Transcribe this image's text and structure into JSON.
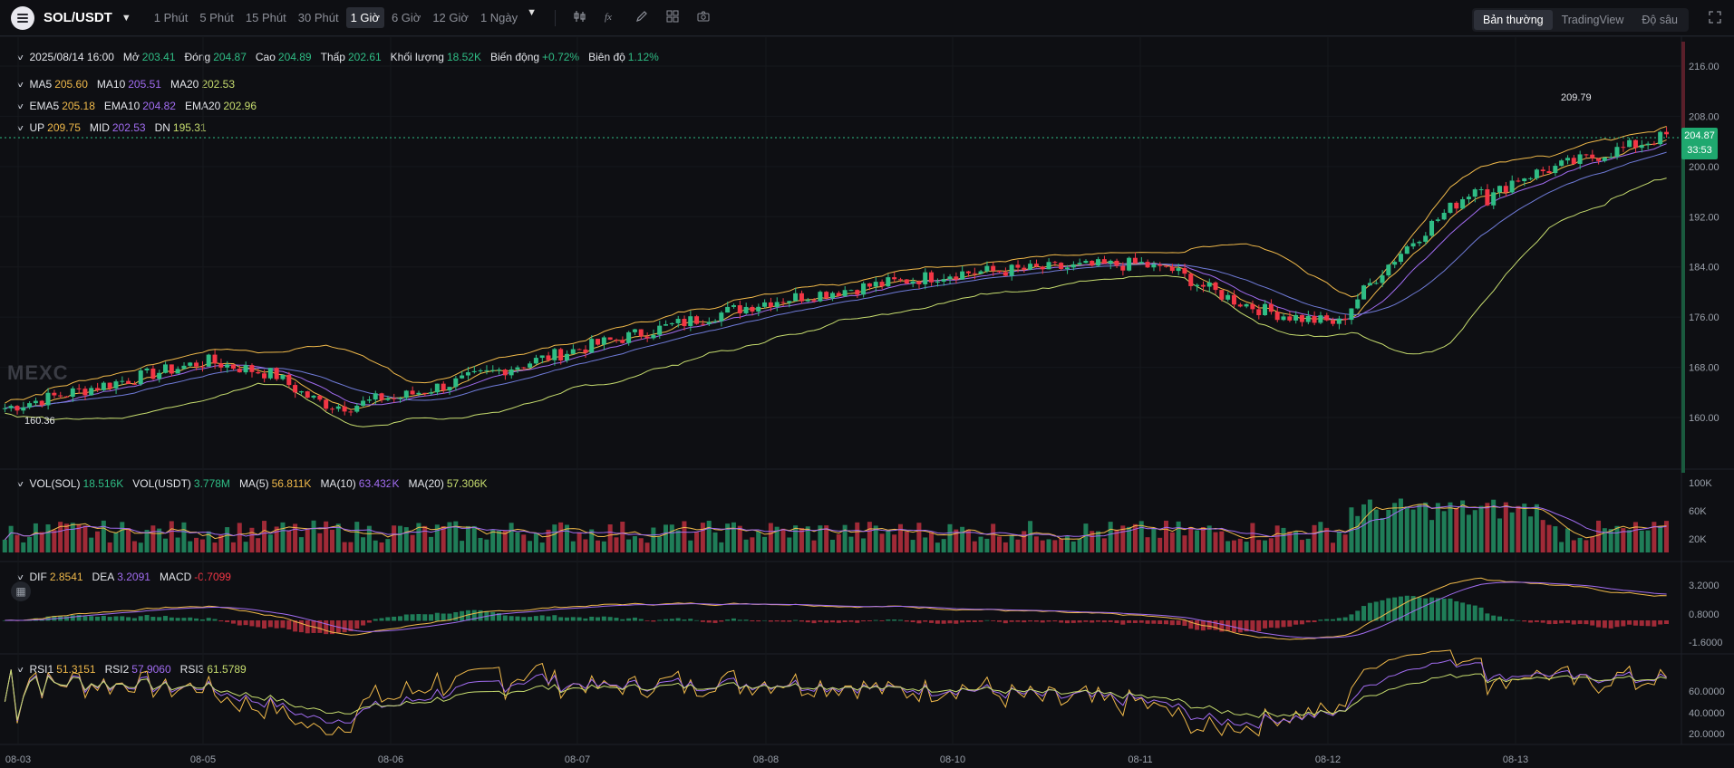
{
  "toolbar": {
    "symbol": "SOL/USDT",
    "intervals": [
      "1 Phút",
      "5 Phút",
      "15 Phút",
      "30 Phút",
      "1 Giờ",
      "6 Giờ",
      "12 Giờ",
      "1 Ngày"
    ],
    "active_interval": "1 Giờ",
    "modes": [
      "Bản thường",
      "TradingView",
      "Độ sâu"
    ],
    "active_mode": "Bản thường"
  },
  "ohlc": {
    "date": "2025/08/14 16:00",
    "open_label": "Mở",
    "open": "203.41",
    "close_label": "Đóng",
    "close": "204.87",
    "high_label": "Cao",
    "high": "204.89",
    "low_label": "Thấp",
    "low": "202.61",
    "vol_label": "Khối lượng",
    "vol": "18.52K",
    "change_label": "Biến động",
    "change": "+0.72%",
    "amp_label": "Biên độ",
    "amp": "1.12%"
  },
  "ma": {
    "ma5_label": "MA5",
    "ma5": "205.60",
    "ma10_label": "MA10",
    "ma10": "205.51",
    "ma20_label": "MA20",
    "ma20": "202.53"
  },
  "ema": {
    "ema5_label": "EMA5",
    "ema5": "205.18",
    "ema10_label": "EMA10",
    "ema10": "204.82",
    "ema20_label": "EMA20",
    "ema20": "202.96"
  },
  "boll": {
    "up_label": "UP",
    "up": "209.75",
    "mid_label": "MID",
    "mid": "202.53",
    "dn_label": "DN",
    "dn": "195.31"
  },
  "volume": {
    "sol_label": "VOL(SOL)",
    "sol": "18.516K",
    "usdt_label": "VOL(USDT)",
    "usdt": "3.778M",
    "ma5_label": "MA(5)",
    "ma5": "56.811K",
    "ma10_label": "MA(10)",
    "ma10": "63.432K",
    "ma20_label": "MA(20)",
    "ma20": "57.306K"
  },
  "macd": {
    "dif_label": "DIF",
    "dif": "2.8541",
    "dea_label": "DEA",
    "dea": "3.2091",
    "macd_label": "MACD",
    "macd": "-0.7099"
  },
  "rsi": {
    "rsi1_label": "RSI1",
    "rsi1": "51.3151",
    "rsi2_label": "RSI2",
    "rsi2": "57.9060",
    "rsi3_label": "RSI3",
    "rsi3": "61.5789"
  },
  "price_axis": [
    "216.00",
    "208.00",
    "200.00",
    "192.00",
    "184.00",
    "176.00",
    "168.00",
    "160.00"
  ],
  "volume_axis": [
    "100K",
    "60K",
    "20K"
  ],
  "macd_axis": [
    "3.2000",
    "0.8000",
    "-1.6000"
  ],
  "rsi_axis": [
    "60.0000",
    "40.0000",
    "20.0000"
  ],
  "date_axis": [
    "08-03",
    "08-05",
    "08-06",
    "08-07",
    "08-08",
    "08-10",
    "08-11",
    "08-12",
    "08-13"
  ],
  "last_price": {
    "price": "204.87",
    "countdown": "33:53"
  },
  "high_mark": "209.79",
  "low_mark": "160.36",
  "watermark": "MEXC",
  "colors": {
    "up": "#2fbd85",
    "down": "#f23645",
    "ma5": "#f0b94a",
    "ma10": "#a16cf0",
    "ma20": "#c7dd6f"
  },
  "chart_data": {
    "type": "line",
    "series": [
      {
        "name": "SOL/USDT",
        "x": [
          "08-03",
          "08-05",
          "08-06",
          "08-07",
          "08-08",
          "08-10",
          "08-11",
          "08-12",
          "08-13",
          "08-14"
        ],
        "values": [
          161.5,
          169.0,
          163.0,
          171.0,
          178.5,
          183.0,
          184.5,
          175.0,
          198.0,
          204.87
        ]
      }
    ],
    "ylim": [
      156,
      220
    ]
  }
}
